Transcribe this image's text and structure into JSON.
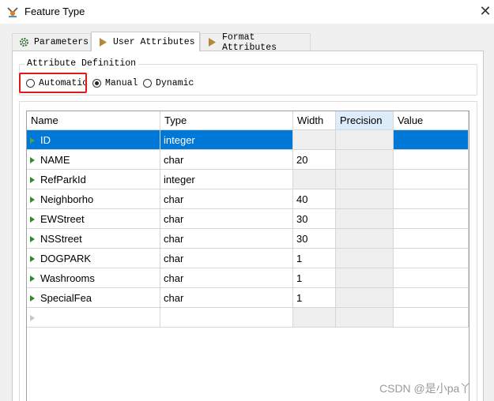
{
  "window": {
    "title": "Feature Type",
    "close_label": "✕",
    "app_icon": "fme-feature-type-icon"
  },
  "tabs": [
    {
      "label": "Parameters",
      "icon": "gear-icon",
      "active": false
    },
    {
      "label": "User Attributes",
      "icon": "arrow-icon",
      "active": true
    },
    {
      "label": "Format Attributes",
      "icon": "arrow-icon",
      "active": false
    }
  ],
  "attribute_definition": {
    "label": "Attribute Definition",
    "options": [
      {
        "label": "Automatic",
        "selected": false
      },
      {
        "label": "Manual",
        "selected": true
      },
      {
        "label": "Dynamic",
        "selected": false
      }
    ],
    "highlight_color": "#e21919"
  },
  "table": {
    "columns": [
      "Name",
      "Type",
      "Width",
      "Precision",
      "Value"
    ],
    "rows": [
      {
        "name": "ID",
        "type": "integer",
        "width": "",
        "precision": "",
        "value": ""
      },
      {
        "name": "NAME",
        "type": "char",
        "width": "20",
        "precision": "",
        "value": ""
      },
      {
        "name": "RefParkId",
        "type": "integer",
        "width": "",
        "precision": "",
        "value": ""
      },
      {
        "name": "Neighborho",
        "type": "char",
        "width": "40",
        "precision": "",
        "value": ""
      },
      {
        "name": "EWStreet",
        "type": "char",
        "width": "30",
        "precision": "",
        "value": ""
      },
      {
        "name": "NSStreet",
        "type": "char",
        "width": "30",
        "precision": "",
        "value": ""
      },
      {
        "name": "DOGPARK",
        "type": "char",
        "width": "1",
        "precision": "",
        "value": ""
      },
      {
        "name": "Washrooms",
        "type": "char",
        "width": "1",
        "precision": "",
        "value": ""
      },
      {
        "name": "SpecialFea",
        "type": "char",
        "width": "1",
        "precision": "",
        "value": ""
      }
    ],
    "selected_row": 0,
    "selection_color": "#0078d7",
    "row_marker_color": "#2f8a2f"
  },
  "watermark": "CSDN @是小pa丫"
}
